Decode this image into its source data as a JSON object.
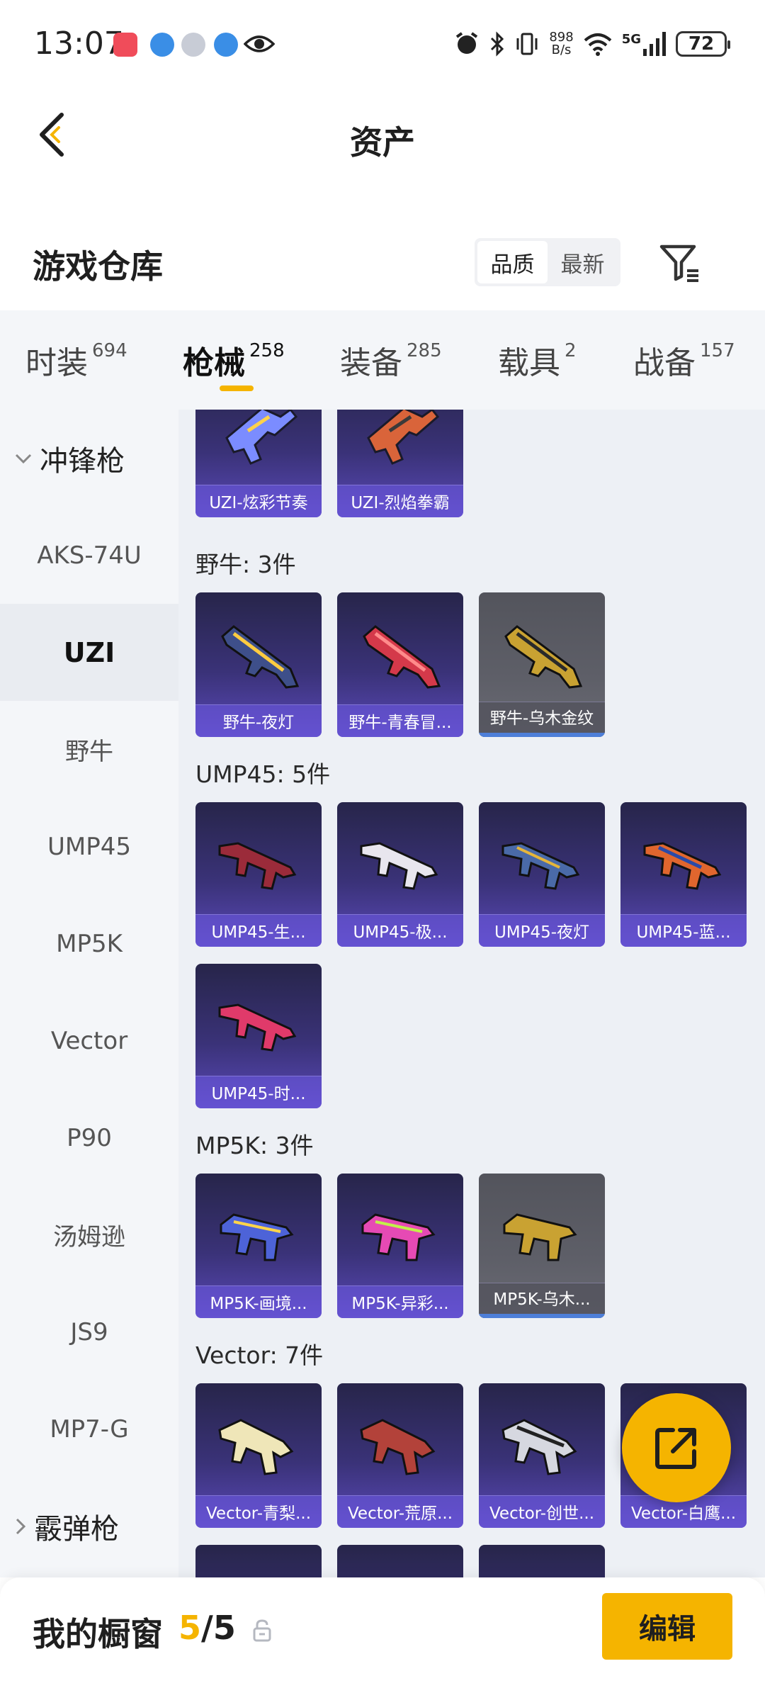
{
  "status_bar": {
    "time": "13:07",
    "net_speed_value": "898",
    "net_speed_unit": "B/s",
    "network": "5G",
    "battery": "72"
  },
  "header": {
    "title": "资产"
  },
  "warehouse": {
    "title": "游戏仓库",
    "sort_options": [
      "品质",
      "最新"
    ],
    "active_sort": "品质"
  },
  "tabs": [
    {
      "label": "时装",
      "count": "694"
    },
    {
      "label": "枪械",
      "count": "258"
    },
    {
      "label": "装备",
      "count": "285"
    },
    {
      "label": "载具",
      "count": "2"
    },
    {
      "label": "战备",
      "count": "157"
    }
  ],
  "active_tab": "枪械",
  "sidebar": {
    "group_open": "冲锋枪",
    "items": [
      "AKS-74U",
      "UZI",
      "野牛",
      "UMP45",
      "MP5K",
      "Vector",
      "P90",
      "汤姆逊",
      "JS9",
      "MP7-G"
    ],
    "active_item": "UZI",
    "group_closed": "霰弹枪"
  },
  "content": {
    "partial_row": [
      "UZI-炫彩节奏",
      "UZI-烈焰拳霸"
    ],
    "groups": [
      {
        "header": "野牛: 3件",
        "items": [
          "野牛-夜灯",
          "野牛-青春冒...",
          "野牛-乌木金纹"
        ]
      },
      {
        "header": "UMP45: 5件",
        "items": [
          "UMP45-生...",
          "UMP45-极...",
          "UMP45-夜灯",
          "UMP45-蓝...",
          "UMP45-时..."
        ]
      },
      {
        "header": "MP5K: 3件",
        "items": [
          "MP5K-画境...",
          "MP5K-异彩...",
          "MP5K-乌木..."
        ]
      },
      {
        "header": "Vector: 7件",
        "items": [
          "Vector-青梨...",
          "Vector-荒原...",
          "Vector-创世...",
          "Vector-白鹰..."
        ]
      }
    ]
  },
  "colors": {
    "accent": "#f5b400",
    "card_purple": "#3a3278",
    "card_gray": "#5e5f68"
  },
  "bottom_bar": {
    "label": "我的橱窗",
    "used": "5",
    "separator": "/",
    "total": "5",
    "edit_label": "编辑"
  }
}
